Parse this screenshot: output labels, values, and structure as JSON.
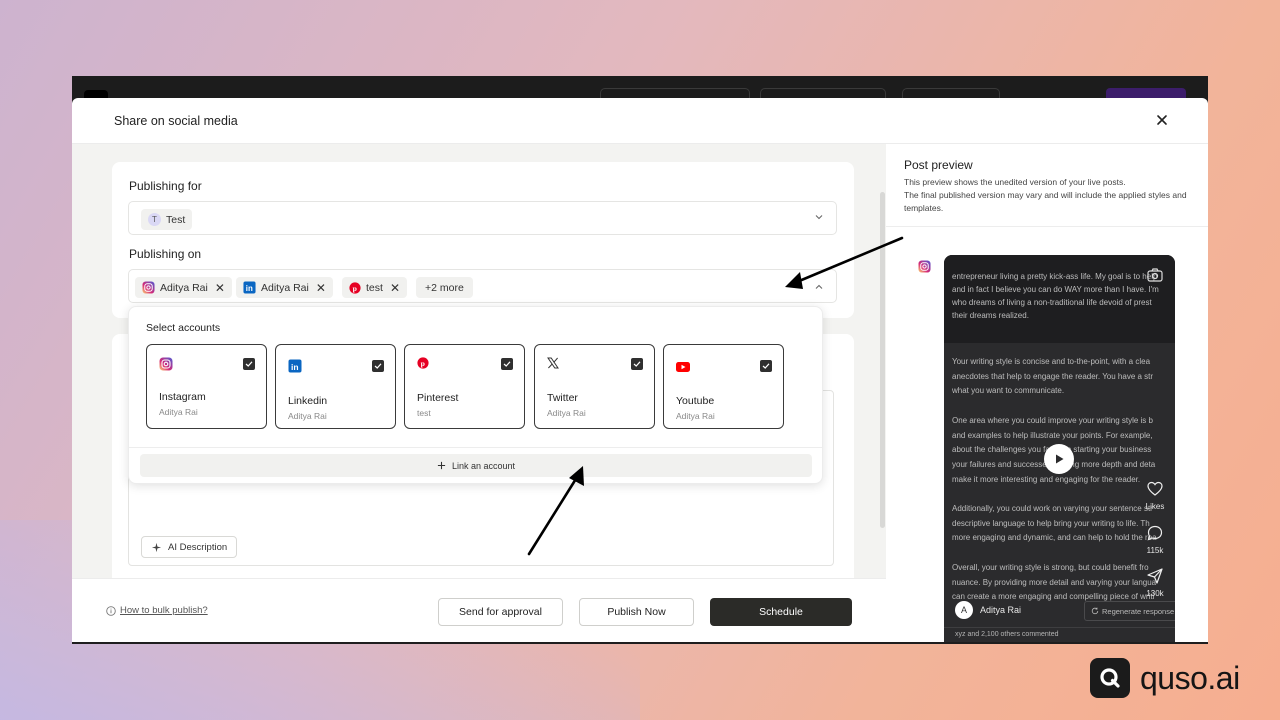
{
  "modal": {
    "title": "Share on social media"
  },
  "form": {
    "publishing_for_label": "Publishing for",
    "publishing_for_value": {
      "initial": "T",
      "name": "Test"
    },
    "publishing_on_label": "Publishing on",
    "selected_chips": [
      {
        "label": "Aditya Rai",
        "platform": "instagram-icon"
      },
      {
        "label": "Aditya Rai",
        "platform": "linkedin-icon"
      },
      {
        "label": "test",
        "platform": "pinterest-icon"
      }
    ],
    "more_chip": "+2 more",
    "ai_description_label": "AI Description"
  },
  "dropdown": {
    "title": "Select accounts",
    "accounts": [
      {
        "platform": "Instagram",
        "user": "Aditya Rai",
        "checked": true
      },
      {
        "platform": "Linkedin",
        "user": "Aditya Rai",
        "checked": true
      },
      {
        "platform": "Pinterest",
        "user": "test",
        "checked": true
      },
      {
        "platform": "Twitter",
        "user": "Aditya Rai",
        "checked": true
      },
      {
        "platform": "Youtube",
        "user": "Aditya Rai",
        "checked": true
      }
    ],
    "link_account_label": "Link an account"
  },
  "footer": {
    "bulk_link": "How to bulk publish?",
    "send_approval": "Send for approval",
    "publish_now": "Publish Now",
    "schedule": "Schedule"
  },
  "preview": {
    "title": "Post preview",
    "desc_line1": "This preview shows the unedited version of your live posts.",
    "desc_line2": "The final published version may vary and will include the applied styles and templates.",
    "top_lines": [
      "entrepreneur living a pretty kick-ass life. My goal is to help",
      "and in fact I believe you can do WAY more than I have. I'm",
      "who dreams of living a non-traditional life devoid of prest",
      "their dreams realized."
    ],
    "body_lines": [
      "Your writing style is concise and to-the-point, with a clea",
      "anecdotes that help to engage the reader. You have a str",
      "what you want to communicate.",
      "",
      "One area where you could improve your writing style is b",
      "and examples to help illustrate your points. For example,",
      "about the challenges you faced in starting your business",
      "your failures and successes, adding more depth and deta",
      "make it more interesting and engaging for the reader.",
      "",
      "Additionally, you could work on varying your sentence str",
      "descriptive language to help bring your writing to life. Th",
      "more engaging and dynamic, and can help to hold the rea",
      "",
      "Overall, your writing style is strong, but could benefit fro",
      "nuance. By providing more detail and varying your langua",
      "can create a more engaging and compelling piece of writi"
    ],
    "likes_label": "Likes",
    "comments_count": "115k",
    "shares_count": "130k",
    "author_initial": "A",
    "author_name": "Aditya Rai",
    "regenerate_label": "Regenerate response",
    "comment_summary": "xyz and 2,100 others commented"
  },
  "brand": {
    "name": "quso.ai"
  },
  "colors": {
    "accent_dark": "#2b2b28",
    "instagram": "#d6249f",
    "linkedin": "#0a66c2",
    "pinterest": "#e60023",
    "youtube": "#ff0000"
  }
}
